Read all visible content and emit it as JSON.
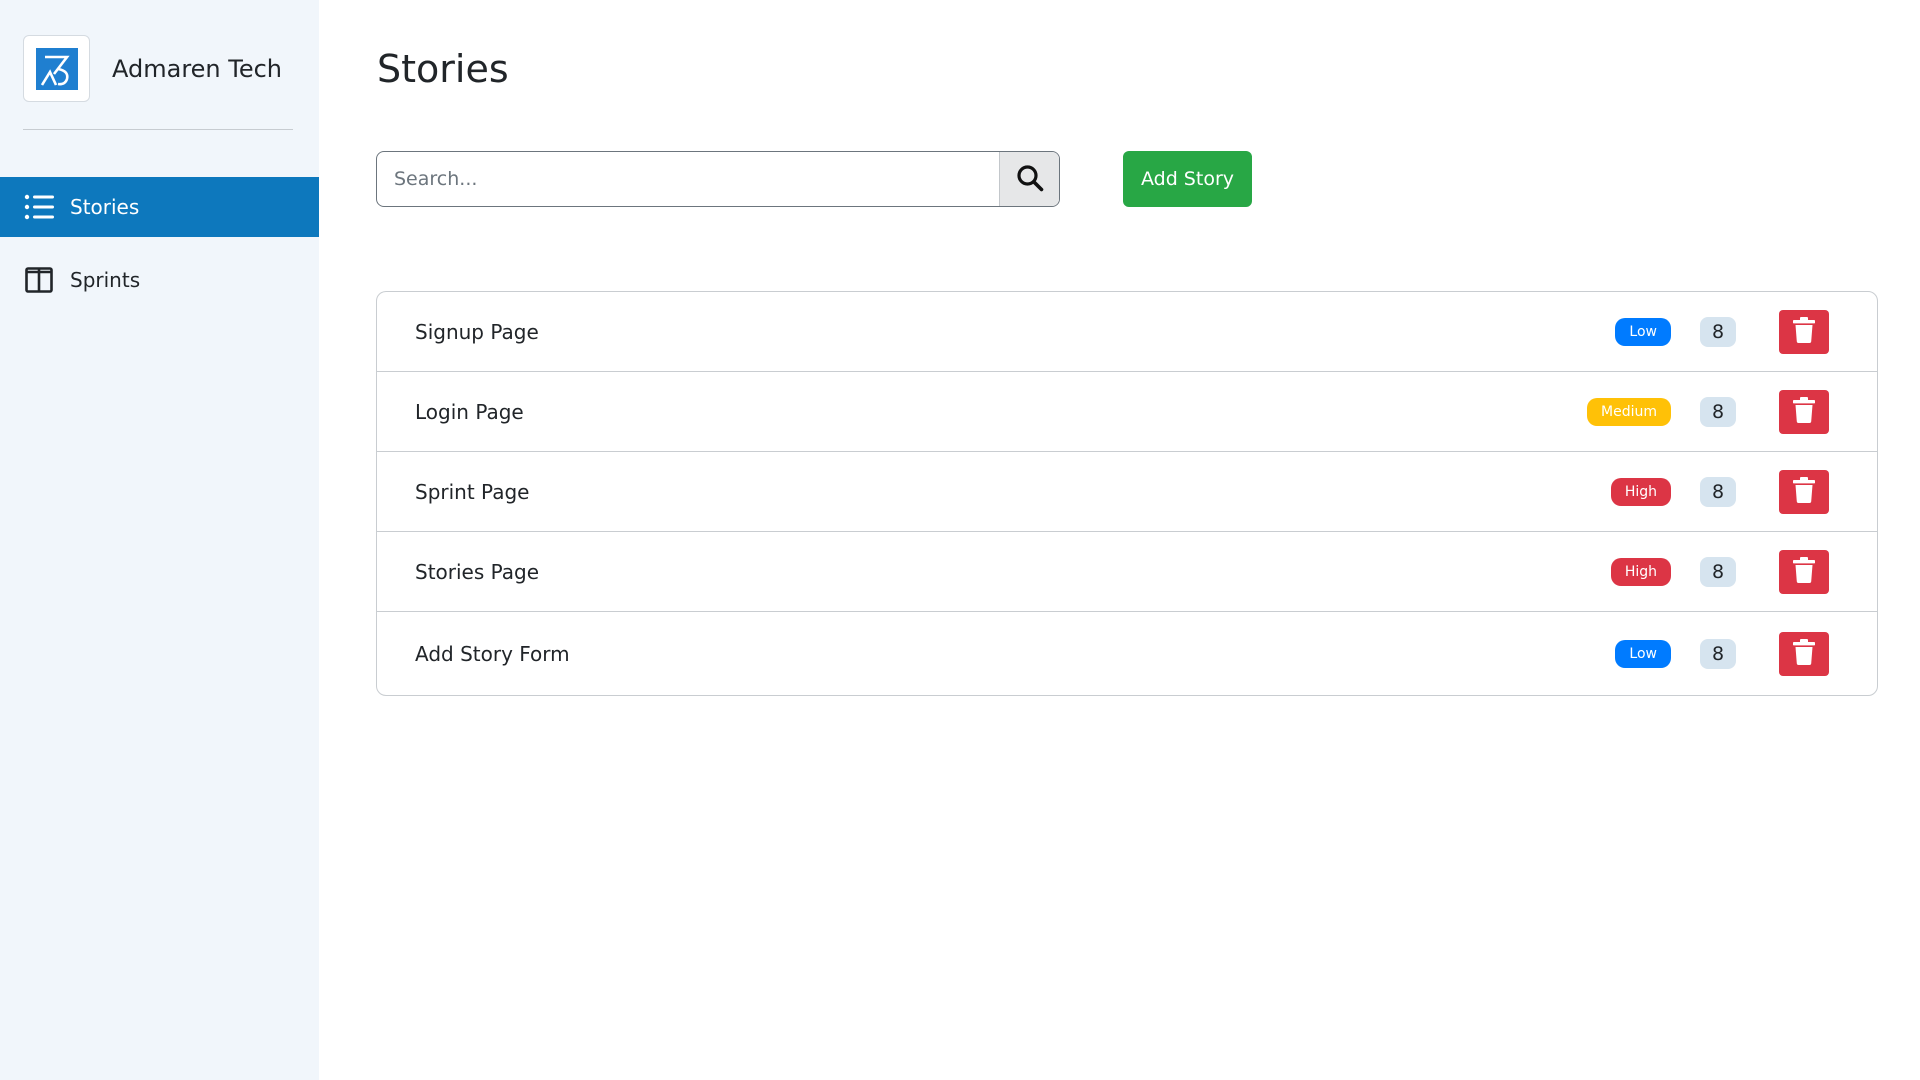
{
  "brand": {
    "name": "Admaren Tech",
    "logo_icon": "admaren-logo-icon"
  },
  "sidebar": {
    "items": [
      {
        "label": "Stories",
        "icon": "list-icon",
        "active": true
      },
      {
        "label": "Sprints",
        "icon": "columns-icon",
        "active": false
      }
    ]
  },
  "main": {
    "title": "Stories",
    "search": {
      "placeholder": "Search...",
      "value": ""
    },
    "add_label": "Add Story"
  },
  "stories": [
    {
      "name": "Signup Page",
      "priority": "Low",
      "points": "8"
    },
    {
      "name": "Login Page",
      "priority": "Medium",
      "points": "8"
    },
    {
      "name": "Sprint Page",
      "priority": "High",
      "points": "8"
    },
    {
      "name": "Stories Page",
      "priority": "High",
      "points": "8"
    },
    {
      "name": "Add Story Form",
      "priority": "Low",
      "points": "8"
    }
  ],
  "colors": {
    "sidebar_bg": "#f1f6fb",
    "active_nav": "#0d78bd",
    "add_button": "#28a745",
    "delete_button": "#dc3545",
    "priority_low": "#007bff",
    "priority_medium": "#ffc107",
    "priority_high": "#dc3545",
    "points_badge": "#d6e4ef"
  }
}
